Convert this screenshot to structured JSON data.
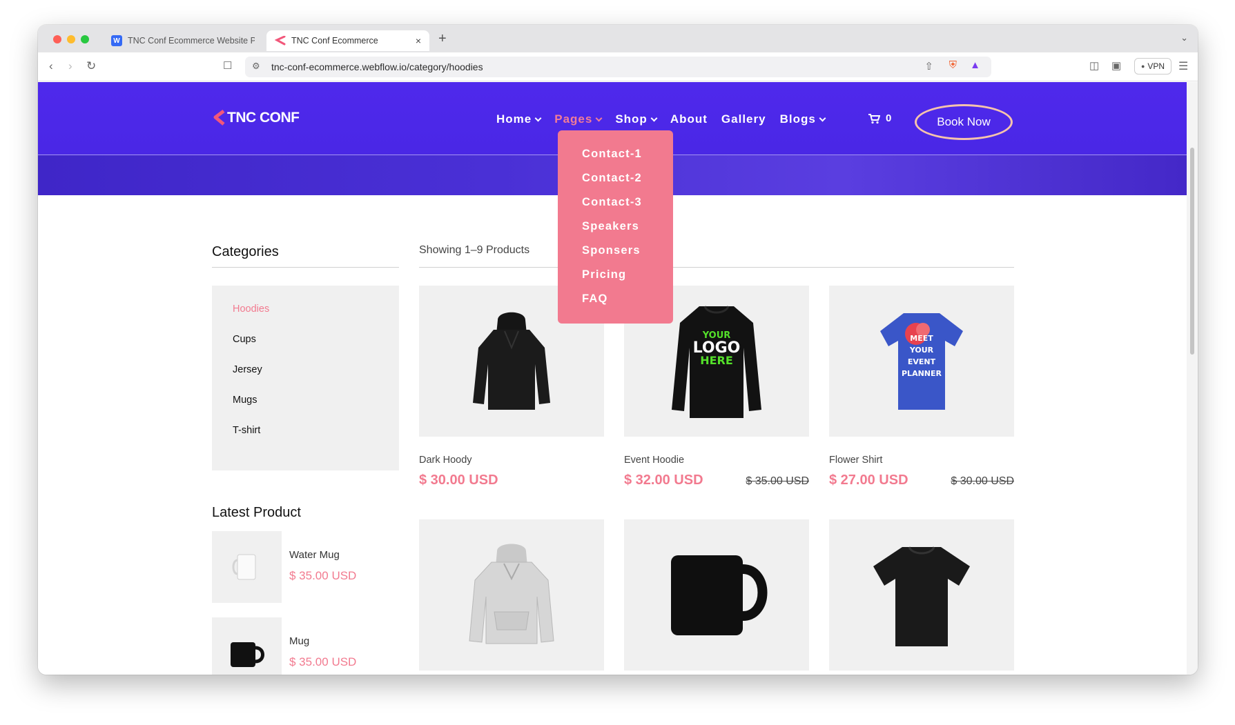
{
  "browser": {
    "tabs": [
      {
        "title": "TNC Conf Ecommerce Website P..."
      },
      {
        "title": "TNC Conf Ecommerce",
        "close": "×"
      }
    ],
    "new_tab": "+",
    "url": "tnc-conf-ecommerce.webflow.io/category/hoodies",
    "vpn_label": "VPN"
  },
  "header": {
    "logo_text": "TNC CONF",
    "nav": [
      {
        "label": "Home",
        "has_dropdown": true
      },
      {
        "label": "Pages",
        "has_dropdown": true,
        "active": true
      },
      {
        "label": "Shop",
        "has_dropdown": true
      },
      {
        "label": "About",
        "has_dropdown": false
      },
      {
        "label": "Gallery",
        "has_dropdown": false
      },
      {
        "label": "Blogs",
        "has_dropdown": true
      }
    ],
    "cart_count": "0",
    "book_now": "Book Now"
  },
  "pages_dropdown": [
    "Contact-1",
    "Contact-2",
    "Contact-3",
    "Speakers",
    "Sponsers",
    "Pricing",
    "FAQ"
  ],
  "sidebar": {
    "categories_title": "Categories",
    "categories": [
      {
        "label": "Hoodies",
        "active": true
      },
      {
        "label": "Cups"
      },
      {
        "label": "Jersey"
      },
      {
        "label": "Mugs"
      },
      {
        "label": "T-shirt"
      }
    ],
    "latest_title": "Latest Product",
    "latest": [
      {
        "name": "Water Mug",
        "price": "$ 35.00 USD",
        "icon": "white-mug"
      },
      {
        "name": "Mug",
        "price": "$ 35.00 USD",
        "icon": "black-mug"
      }
    ]
  },
  "products": {
    "showing": "Showing 1–9 Products",
    "items": [
      {
        "name": "Dark Hoody",
        "price": "$ 30.00 USD",
        "old_price": "",
        "icon": "dark-hoodie"
      },
      {
        "name": "Event Hoodie",
        "price": "$ 32.00 USD",
        "old_price": "$ 35.00 USD",
        "icon": "logo-sweatshirt",
        "print": [
          "YOUR",
          "LOGO",
          "HERE"
        ]
      },
      {
        "name": "Flower Shirt",
        "price": "$ 27.00 USD",
        "old_price": "$ 30.00 USD",
        "icon": "flower-tshirt",
        "print": [
          "MEET",
          "YOUR",
          "EVENT",
          "PLANNER"
        ]
      },
      {
        "name": "",
        "price": "",
        "old_price": "",
        "icon": "grey-hoodie"
      },
      {
        "name": "",
        "price": "",
        "old_price": "",
        "icon": "black-mug"
      },
      {
        "name": "",
        "price": "",
        "old_price": "",
        "icon": "black-tshirt"
      }
    ]
  },
  "colors": {
    "brand_purple": "#4f29ec",
    "accent_pink": "#f27a8f"
  }
}
